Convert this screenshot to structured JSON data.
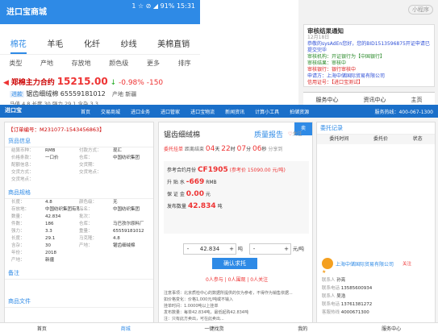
{
  "phone": {
    "status_title": "进口宝商城",
    "status_right": "1 ☆ ⊘ ◢ 91% 15:31",
    "tabs": [
      "棉花",
      "羊毛",
      "化纤",
      "纱线",
      "美棉直销"
    ],
    "filters": [
      "类型",
      "产地",
      "存放地",
      "颜色级",
      "更多",
      "排序"
    ],
    "quote_name": "郑棉主力合约",
    "quote_price": "15215.00",
    "quote_arrow": "↓",
    "quote_change": "-0.98%",
    "quote_diff": "-150",
    "contract_tag": "进款",
    "contract_code": "锯齿细绒棉 65559181012",
    "contract_origin_label": "产地",
    "contract_origin": "新疆",
    "spec_line": "马值 4.8  长度 30  强力 29.1  含杂 3.3"
  },
  "notify": {
    "bar_text": "小程序",
    "title": "审核结果通知",
    "date": "12月18日",
    "greeting": "恭敬的sysAdEn您好，您的BID1513596875开证申请已",
    "status_line": "提交完毕",
    "line1": "审核机构：开证银行为【中国银行】",
    "line2": "审核结果：审核中",
    "line3": "审核银行：银行审核中",
    "line4": "申请方：上海中储国际贸易有限公司",
    "line5": "信用证号：【进口宝测试】",
    "footer": [
      "服务中心",
      "资讯中心",
      "主页"
    ]
  },
  "web": {
    "logo": "进口宝",
    "nav": [
      "首页",
      "交易商城",
      "进口业务",
      "进口管家",
      "进口宝物流",
      "新闻资讯",
      "计算小工具",
      "拍储资源"
    ],
    "tel": "服务热线：400-067-1300",
    "order_label": "【订单编号：M231077-1543456863】",
    "sec_goods": "货品信息",
    "goods_rows": [
      [
        "结算币种：",
        "RMB",
        "付款方式：",
        "现汇"
      ],
      [
        "价格条款：",
        "一口价",
        "仓库：",
        "中国纺织集团"
      ],
      [
        "配额信息：",
        "",
        "交货期：",
        ""
      ],
      [
        "交货方式：",
        "",
        "交货地点：",
        ""
      ],
      [
        "交货地点：",
        "",
        "",
        ""
      ]
    ],
    "sec_spec": "商品规格",
    "spec_rows": [
      [
        "长度：",
        "4.8",
        "颜色级：",
        "无"
      ],
      [
        "存放地：",
        "中国纺织集团有限",
        "品名：",
        "中国纺织集团"
      ],
      [
        "数量：",
        "42.834",
        "批次：",
        ""
      ],
      [
        "件数：",
        "186",
        "仓库：",
        "马巴孜尔原料厂"
      ],
      [
        "强力：",
        "3.3",
        "重量：",
        "65559181012"
      ],
      [
        "长度：",
        "29.1",
        "马克隆：",
        "4.8"
      ],
      [
        "含杂：",
        "30",
        "产地：",
        "锯齿细绒棉"
      ],
      [
        "年份：",
        "2018",
        "",
        ""
      ],
      [
        "产地：",
        "新疆",
        "",
        ""
      ]
    ],
    "sec_remark": "备注",
    "sec_attach": "商品文件",
    "product_name": "锯齿细绒棉",
    "quality_link": "质量报告",
    "favorite": "关注",
    "timer_label": "委托挂单",
    "timer_text": "距离结束",
    "timer_vals": [
      "04",
      "22",
      "07",
      "06"
    ],
    "timer_units": [
      "天",
      "时",
      "分",
      "秒"
    ],
    "share": "分享到",
    "ref_label": "参考合约月份",
    "ref_value": "CF1905",
    "ref_note": "(参考价 15090.00 元/吨)",
    "price_label": "升 贴 水",
    "price_value": "-669",
    "price_unit": "RMB",
    "margin_label": "保 证 金",
    "margin_value": "0.00",
    "margin_unit": "元",
    "qty_label": "发布数量",
    "qty_value": "42.834",
    "qty_unit": "吨",
    "input_qty": "42.834",
    "input_qty_unit": "吨",
    "input_price_unit": "元/吨",
    "submit": "确认求托",
    "stats": "0人参与 | 0人围观 | 0人关注",
    "notes": [
      "注意事项：北京质检中心的数据所提供的仅为参考，不得作为销售依据...",
      "如价格变化：价格1,000元/吨或不输入",
      "挂单时间：1.0000吨以上挂单",
      "发布数量：每单42.834吨，最低起购42.834吨",
      "注：只有此方卖出，可在此卖出..."
    ],
    "right_title": "委托记录",
    "right_cols": [
      "委托时间",
      "委托价",
      "状态"
    ],
    "company": "上海中储国际贸易有限公司",
    "company_follow": "关注",
    "contact_label": "联系人",
    "contact": "孙亮",
    "phone1_label": "联系电话",
    "phone1": "13585600934",
    "contact2_label": "联系人",
    "contact2": "吴浩",
    "phone2_label": "联系电话",
    "phone2": "13761381272",
    "phone3_label": "客服热线",
    "phone3": "4000671300",
    "bottom": [
      "首页",
      "商城",
      "一键找货",
      "我的",
      "服务中心"
    ]
  }
}
